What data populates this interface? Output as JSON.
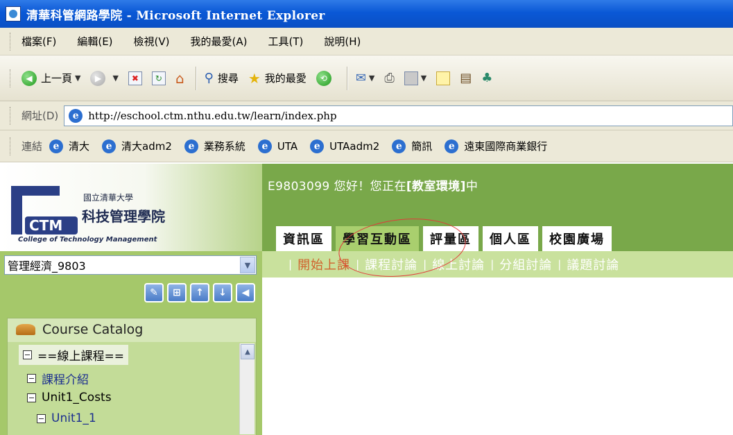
{
  "window": {
    "title": "清華科管網路學院 - Microsoft Internet Explorer"
  },
  "menu": [
    "檔案(F)",
    "編輯(E)",
    "檢視(V)",
    "我的最愛(A)",
    "工具(T)",
    "說明(H)"
  ],
  "toolbar": {
    "back_label": "上一頁",
    "search_label": "搜尋",
    "favorites_label": "我的最愛"
  },
  "address": {
    "label": "網址(D)",
    "url": "http://eschool.ctm.nthu.edu.tw/learn/index.php"
  },
  "links": {
    "label": "連結",
    "items": [
      "清大",
      "清大adm2",
      "業務系統",
      "UTA",
      "UTAadm2",
      "簡訊",
      "遠東國際商業銀行"
    ]
  },
  "logo": {
    "university": "國立清華大學",
    "college": "科技管理學院",
    "english": "College of Technology Management"
  },
  "course_select": {
    "value": "管理經濟_9803"
  },
  "catalog": {
    "title": "Course Catalog",
    "tree": [
      {
        "label": "==線上課程=="
      },
      {
        "label": "課程介紹"
      },
      {
        "label": "Unit1_Costs"
      },
      {
        "label": "Unit1_1"
      }
    ]
  },
  "header": {
    "greeting_prefix": "E9803099 您好！您正在",
    "greeting_bold": "[教室環境]",
    "greeting_suffix": "中"
  },
  "tabs": [
    "資訊區",
    "學習互動區",
    "評量區",
    "個人區",
    "校園廣場"
  ],
  "subnav": [
    "開始上課",
    "課程討論",
    "線上討論",
    "分組討論",
    "議題討論"
  ],
  "colors": {
    "sidebar": "#a5c86a",
    "header": "#79a84a",
    "subnav": "#c9e19d",
    "active_subnav": "#d0622d",
    "annotation": "#e23a3a"
  }
}
